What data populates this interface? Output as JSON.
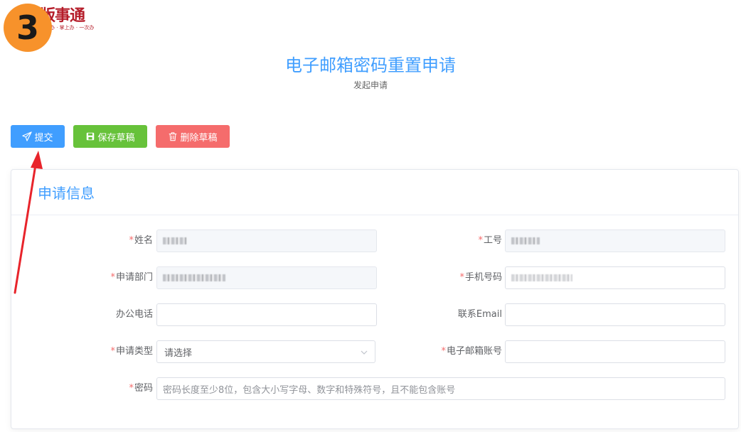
{
  "logo": {
    "name": "版事通",
    "slogan": "网上办 · 掌上办 · 一次办"
  },
  "step_badge": "3",
  "page": {
    "title": "电子邮箱密码重置申请",
    "subtitle": "发起申请"
  },
  "toolbar": {
    "submit_label": "提交",
    "save_draft_label": "保存草稿",
    "delete_draft_label": "删除草稿"
  },
  "section": {
    "title": "申请信息"
  },
  "form": {
    "name_label": "姓名",
    "employee_id_label": "工号",
    "department_label": "申请部门",
    "phone_label": "手机号码",
    "office_phone_label": "办公电话",
    "email_label": "联系Email",
    "type_label": "申请类型",
    "type_value": "请选择",
    "mailbox_label": "电子邮箱账号",
    "password_label": "密码",
    "password_placeholder": "密码长度至少8位，包含大小写字母、数字和特殊符号，且不能包含账号"
  },
  "colors": {
    "primary": "#409eff",
    "success": "#67c23a",
    "danger": "#f56c6c",
    "badge": "#f7922b",
    "annotation_arrow": "#e8242b"
  },
  "icons": {
    "submit": "send-icon",
    "save": "save-icon",
    "delete": "trash-icon",
    "select": "chevron-down-icon"
  }
}
